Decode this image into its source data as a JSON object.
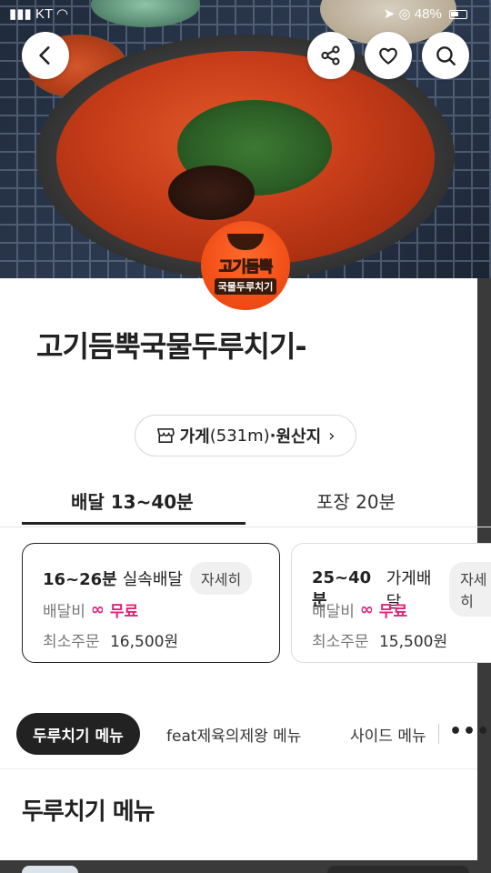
{
  "status_bar": {
    "carrier": "KT",
    "battery": "48%"
  },
  "store": {
    "name": "고기듬뿍국물두루치기-",
    "logo_line1": "고기듬뿍",
    "logo_line2": "국물두루치기"
  },
  "info_chip": {
    "label_store": "가게",
    "distance": "(531m)",
    "separator": "·",
    "label_origin": "원산지"
  },
  "tabs": [
    {
      "label": "배달 13~40분",
      "active": true
    },
    {
      "label": "포장 20분",
      "active": false
    }
  ],
  "delivery_options": [
    {
      "time": "16~26분",
      "type": "실속배달",
      "detail": "자세히",
      "fee_label": "배달비",
      "fee_value": "무료",
      "min_label": "최소주문",
      "min_value": "16,500원"
    },
    {
      "time": "25~40분",
      "type": "가게배달",
      "detail": "자세히",
      "fee_label": "배달비",
      "fee_value": "무료",
      "min_label": "최소주문",
      "min_value": "15,500원"
    }
  ],
  "menu_categories": [
    "두루치기 메뉴",
    "feat제육의제왕 메뉴",
    "사이드 메뉴"
  ],
  "section_title": "두루치기 메뉴",
  "colors": {
    "accent_pink": "#e0247a",
    "logo_orange": "#ef4b15"
  },
  "icons": [
    "back-icon",
    "share-icon",
    "heart-icon",
    "search-icon",
    "store-icon",
    "chevron-right-icon",
    "more-icon"
  ]
}
